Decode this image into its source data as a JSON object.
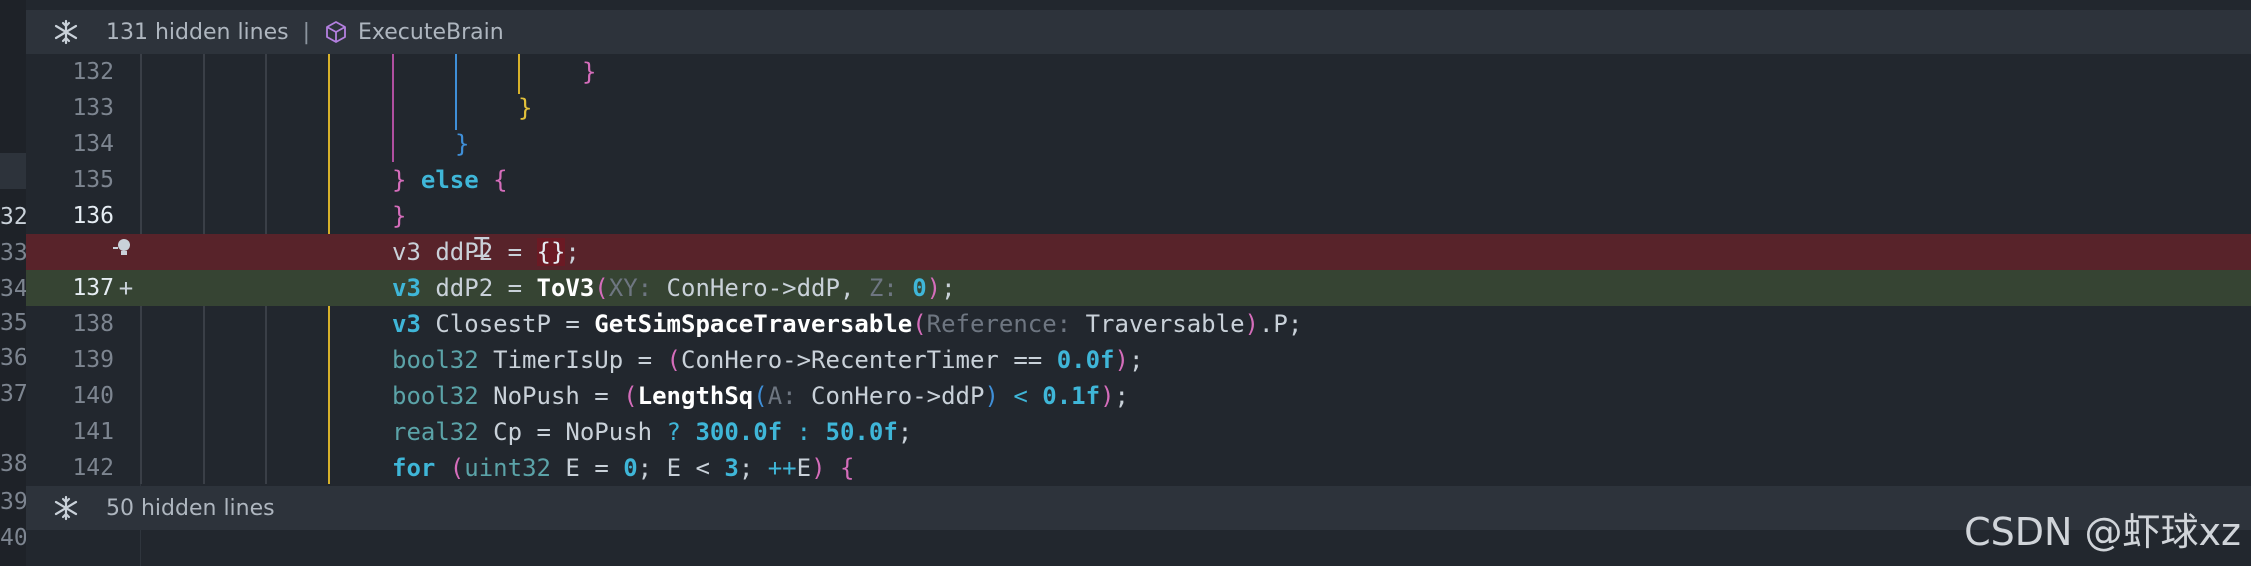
{
  "editor": {
    "top_fold": {
      "label": "131 hidden lines",
      "separator": "|",
      "scope": "ExecuteBrain"
    },
    "bottom_fold": {
      "label": "50 hidden lines"
    },
    "outer_gutter": [
      "32",
      "33",
      "34",
      "35",
      "36",
      "37",
      "38",
      "39",
      "40"
    ],
    "lines": [
      {
        "num": "132",
        "type": "context"
      },
      {
        "num": "133",
        "type": "context"
      },
      {
        "num": "134",
        "type": "context"
      },
      {
        "num": "135",
        "type": "context",
        "else_kw": "else"
      },
      {
        "num": "136",
        "type": "context"
      },
      {
        "num": "",
        "type": "deleted",
        "text_a": "v3 ddP2 = ",
        "text_b": "{}",
        "text_c": ";"
      },
      {
        "num": "137",
        "marker": "+",
        "type": "added",
        "t1": "v3",
        "t2": " ddP2 = ",
        "fn": "ToV3",
        "p1": "(",
        "h1": "XY:",
        "a1": " ConHero->ddP",
        "comma": ", ",
        "h2": "Z:",
        "n1": " 0",
        "p2": ")",
        "end": ";"
      },
      {
        "num": "138",
        "type": "context",
        "t1": "v3",
        "t2": " ClosestP = ",
        "fn": "GetSimSpaceTraversable",
        "p1": "(",
        "h1": "Reference:",
        "a1": " Traversable",
        "p2": ")",
        "end": ".P;"
      },
      {
        "num": "139",
        "type": "context",
        "t1": "bool32",
        "t2": " TimerIsUp = ",
        "p1": "(",
        "a1": "ConHero->RecenterTimer == ",
        "n1": "0.0f",
        "p2": ")",
        "end": ";"
      },
      {
        "num": "140",
        "type": "context",
        "t1": "bool32",
        "t2": " NoPush = ",
        "p1": "(",
        "fn": "LengthSq",
        "p1b": "(",
        "h1": "A:",
        "a1": " ConHero->ddP",
        "p2b": ")",
        "op": " < ",
        "n1": "0.1f",
        "p2": ")",
        "end": ";"
      },
      {
        "num": "141",
        "type": "context",
        "t1": "real32",
        "t2": " Cp = NoPush ",
        "op": "?",
        "n1": " 300.0f",
        "op2": " : ",
        "n2": "50.0f",
        "end": ";"
      },
      {
        "num": "142",
        "type": "context",
        "t1": "for",
        "p1": " (",
        "ty": "uint32",
        "a1": " E = ",
        "n1": "0",
        "a2": "; E < ",
        "n2": "3",
        "a3": "; ",
        "op": "++",
        "a4": "E",
        "p2": ")",
        "br": " {"
      }
    ],
    "braces": {
      "close": "}",
      "open": "{"
    }
  },
  "watermark": {
    "text": "CSDN @虾球xz"
  },
  "colors": {
    "deleted_bg": "#58232a",
    "added_bg": "#364433",
    "fold_bg": "#2d333b",
    "editor_bg": "#22272e"
  }
}
